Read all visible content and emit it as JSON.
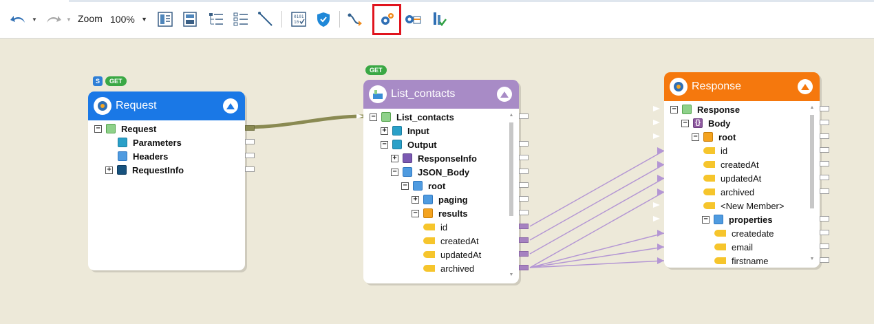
{
  "toolbar": {
    "zoom_label": "Zoom",
    "zoom_value": "100%",
    "icons": [
      "undo-icon",
      "redo-icon",
      "layout-icon",
      "save-icon",
      "tree-indent-icon",
      "list-view-icon",
      "draw-line-icon",
      "calculator-icon",
      "shield-icon",
      "route-icon",
      "gear-flow-icon",
      "gear-table-icon",
      "validate-icon"
    ]
  },
  "nodes": {
    "request": {
      "badges": {
        "s": "S",
        "method": "GET"
      },
      "title": "Request",
      "items": [
        "Request",
        "Parameters",
        "Headers",
        "RequestInfo"
      ]
    },
    "list_contacts": {
      "badges": {
        "method": "GET"
      },
      "title": "List_contacts",
      "items": [
        "List_contacts",
        "Input",
        "Output",
        "ResponseInfo",
        "JSON_Body",
        "root",
        "paging",
        "results",
        "id",
        "createdAt",
        "updatedAt",
        "archived"
      ]
    },
    "response": {
      "title": "Response",
      "items": [
        "Response",
        "Body",
        "root",
        "id",
        "createdAt",
        "updatedAt",
        "archived",
        "<New Member>",
        "properties",
        "createdate",
        "email",
        "firstname"
      ]
    }
  },
  "colors": {
    "request_header": "#1a78e6",
    "list_header": "#a88bc6",
    "response_header": "#f5780d",
    "wire_main": "#8a8a52",
    "wire_map": "#b496d4",
    "highlight": "#e0141e"
  }
}
